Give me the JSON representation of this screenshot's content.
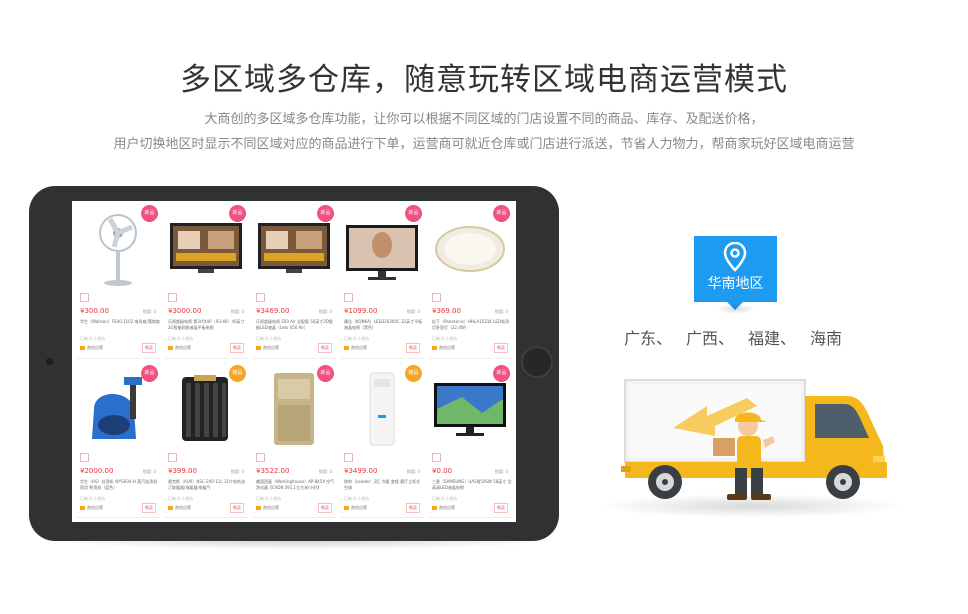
{
  "header": {
    "title": "多区域多仓库，随意玩转区域电商运营模式",
    "subtitle_line1": "大商创的多区域多仓库功能，让你可以根据不同区域的门店设置不同的商品、库存、及配送价格，",
    "subtitle_line2": "用户切换地区时显示不同区域对应的商品进行下单，运营商可就近仓库或门店进行派送，节省人力物力，帮商家玩好区域电商运营"
  },
  "region": {
    "label": "华南地区",
    "cities": [
      "广东、",
      "广西、",
      "福建、",
      "海南"
    ]
  },
  "products": [
    {
      "badge": "新品",
      "badge_color": "#f2517f",
      "price": "¥300.00",
      "stock": "销量: 0",
      "name": "华生（Wahson）FS40-1102 电风扇/落地扇",
      "meta": "已有 0 人评价",
      "shop": "商创自营",
      "btn": "购买",
      "image": "fan"
    },
    {
      "badge": "新品",
      "badge_color": "#f2517f",
      "price": "¥3000.00",
      "stock": "销量: 0",
      "name": "乐视超级电视 第3代X40（X3-40）40英寸2G智能网络液晶平板电视",
      "meta": "已有 0 人评价",
      "shop": "商创自营",
      "btn": "购买",
      "image": "tv-letv"
    },
    {
      "badge": "新品",
      "badge_color": "#f2517f",
      "price": "¥3469.00",
      "stock": "销量: 0",
      "name": "乐视超级电视 S50 Air 全配版 50英寸2D智能LED液晶（Letv S50 Air）",
      "meta": "已有 0 人评价",
      "shop": "商创自营",
      "btn": "购买",
      "image": "tv-letv"
    },
    {
      "badge": "新品",
      "badge_color": "#f2517f",
      "price": "¥1099.00",
      "stock": "销量: 0",
      "name": "康佳（KONKA）LED32S300C 32英寸平板液晶电视（黑色）",
      "meta": "已有 0 人评价",
      "shop": "商创自营",
      "btn": "购买",
      "image": "tv-konka"
    },
    {
      "badge": "新品",
      "badge_color": "#f2517f",
      "price": "¥369.00",
      "stock": "销量: 0",
      "name": "松下（Panasonic）HHLA1521K LED吸顶灯卧室灯（22.4W）",
      "meta": "已有 0 人评价",
      "shop": "商创自营",
      "btn": "购买",
      "image": "lamp"
    },
    {
      "badge": "新品",
      "badge_color": "#f2517f",
      "price": "¥2000.00",
      "stock": "销量: 0",
      "name": "华生（HS）挂烫机 WYS030-H 蒸汽挂烫机 家用 熨烫机（蓝色）",
      "meta": "已有 0 人评价",
      "shop": "商创自营",
      "btn": "购买",
      "image": "steamer"
    },
    {
      "badge": "精品",
      "badge_color": "#f6a623",
      "price": "¥399.00",
      "stock": "销量: 0",
      "name": "奥克斯（AUX）NSC-200-11L 11片电热油汀取暖器/电暖器/电暖气",
      "meta": "已有 0 人评价",
      "shop": "商创自营",
      "btn": "购买",
      "image": "heater"
    },
    {
      "badge": "新品",
      "badge_color": "#f2517f",
      "price": "¥3522.00",
      "stock": "销量: 0",
      "name": "美国西屋（Westinghouse）AP-845X 空气净化器【CADR:391.1立方米/小时】",
      "meta": "已有 0 人评价",
      "shop": "商创自营",
      "btn": "购买",
      "image": "purifier"
    },
    {
      "badge": "精品",
      "badge_color": "#f6a623",
      "price": "¥3499.00",
      "stock": "销量: 0",
      "name": "统帅（Leader）2匹 冷暖 变频 客厅立柜式空调",
      "meta": "已有 0 人评价",
      "shop": "商创自营",
      "btn": "购买",
      "image": "ac"
    },
    {
      "badge": "新品",
      "badge_color": "#f2517f",
      "price": "¥0.00",
      "stock": "销量: 0",
      "name": "三星（SAMSUNG）UA58J50SW 58英寸 全高清LED液晶电视",
      "meta": "已有 0 人评价",
      "shop": "商创自营",
      "btn": "购买",
      "image": "tv-samsung"
    }
  ],
  "colors": {
    "accent_blue": "#1d9bf0",
    "price_red": "#e4393c",
    "badge_pink": "#f2517f",
    "badge_orange": "#f6a623",
    "truck_yellow": "#f5b81c",
    "tablet_body": "#2f3133"
  },
  "icons": {
    "pin": "map-pin-icon",
    "truck": "delivery-truck-icon"
  }
}
